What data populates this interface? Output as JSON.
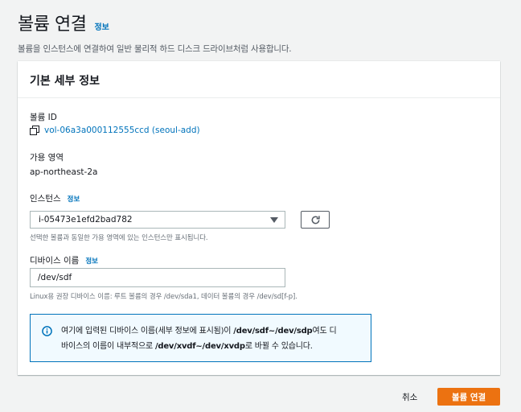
{
  "header": {
    "title": "볼륨 연결",
    "info": "정보",
    "description": "볼륨을 인스턴스에 연결하여 일반 물리적 하드 디스크 드라이브처럼 사용합니다."
  },
  "panel": {
    "title": "기본 세부 정보",
    "volume_id_label": "볼륨 ID",
    "volume_id_value": "vol-06a3a000112555ccd (seoul-add)",
    "az_label": "가용 영역",
    "az_value": "ap-northeast-2a",
    "instance_label": "인스턴스",
    "instance_info": "정보",
    "instance_value": "i-05473e1efd2bad782",
    "instance_hint": "선택한 볼륨과 동일한 가용 영역에 있는 인스턴스만 표시됩니다.",
    "device_label": "디바이스 이름",
    "device_info": "정보",
    "device_value": "/dev/sdf",
    "device_hint": "Linux용 권장 디바이스 이름: 루트 볼륨의 경우 /dev/sda1, 데이터 볼륨의 경우 /dev/sd[f-p].",
    "alert": {
      "t1": "여기에 입력된 디바이스 이름(세부 정보에 표시됨)이 ",
      "b1": "/dev/sdf~/dev/sdp",
      "t2": "여도 디",
      "t3": "바이스의 이름이 내부적으로 ",
      "b2": "/dev/xvdf~/dev/xvdp",
      "t4": "로 바뀔 수 있습니다."
    }
  },
  "footer": {
    "cancel": "취소",
    "submit": "볼륨 연결"
  },
  "colors": {
    "link": "#0073bb",
    "primary": "#ec7211",
    "alert_bg": "#f1faff"
  },
  "icons": [
    "copy-icon",
    "chevron-down-icon",
    "refresh-icon",
    "info-circle-icon"
  ]
}
